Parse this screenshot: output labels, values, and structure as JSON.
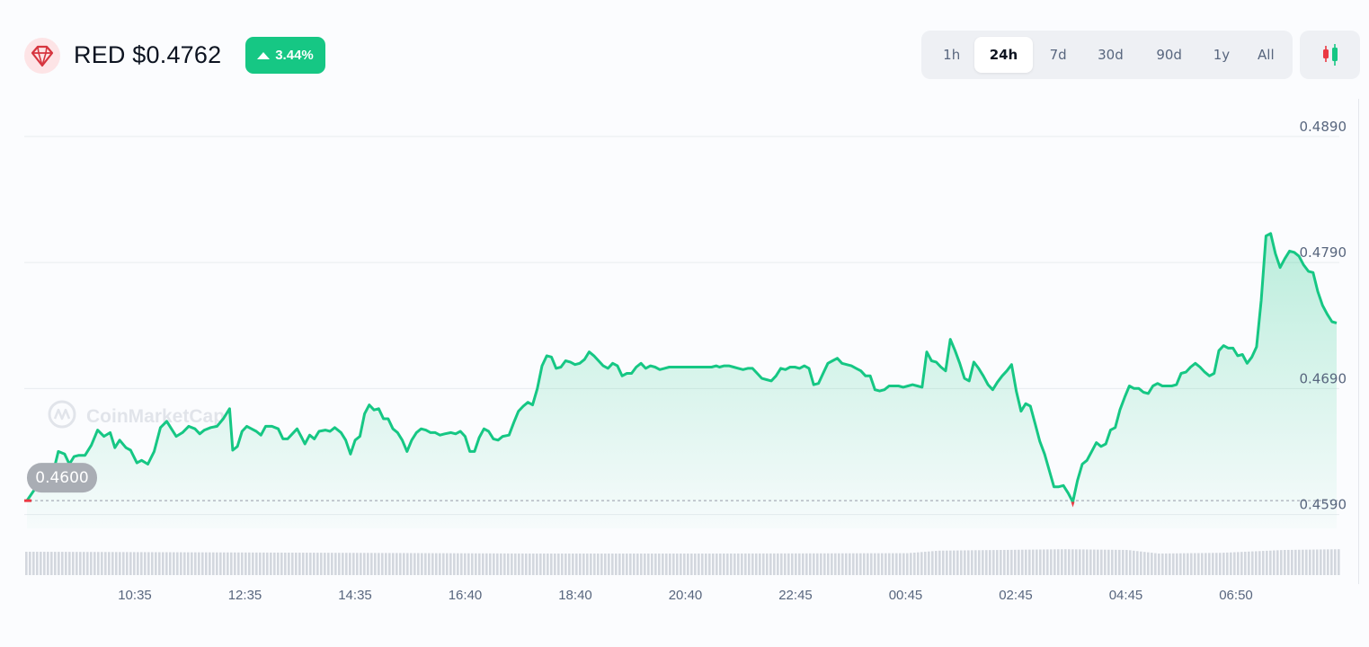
{
  "header": {
    "coin_symbol_price": "RED $0.4762",
    "change_pct": "3.44%",
    "logo_icon": "red-gem-icon",
    "accent_red": "#d6353f"
  },
  "ranges": [
    {
      "label": "1h",
      "active": false
    },
    {
      "label": "24h",
      "active": true
    },
    {
      "label": "7d",
      "active": false
    },
    {
      "label": "30d",
      "active": false
    },
    {
      "label": "90d",
      "active": false
    },
    {
      "label": "1y",
      "active": false
    },
    {
      "label": "All",
      "active": false
    }
  ],
  "candle_toggle_icon": "candlestick-icon",
  "watermark": "CoinMarketCap",
  "chart_data": {
    "type": "line",
    "color_up": "#16c784",
    "color_down": "#ea3943",
    "open_price_label": "0.4600",
    "open_price": 0.4601,
    "y_ticks": [
      "0.4890",
      "0.4790",
      "0.4690",
      "0.4590"
    ],
    "y_tick_values": [
      0.489,
      0.479,
      0.469,
      0.459
    ],
    "ylim": [
      0.4579,
      0.4897
    ],
    "x_ticks": [
      "10:35",
      "12:35",
      "14:35",
      "16:40",
      "18:40",
      "20:40",
      "22:45",
      "00:45",
      "02:45",
      "04:45",
      "06:50"
    ],
    "grid": true,
    "points": [
      [
        0,
        0.4601
      ],
      [
        0.3,
        0.4612
      ],
      [
        0.55,
        0.4618
      ],
      [
        0.8,
        0.462
      ],
      [
        1.0,
        0.464
      ],
      [
        1.2,
        0.4638
      ],
      [
        1.35,
        0.463
      ],
      [
        1.5,
        0.4636
      ],
      [
        1.65,
        0.4637
      ],
      [
        1.85,
        0.4637
      ],
      [
        2.05,
        0.4645
      ],
      [
        2.25,
        0.4657
      ],
      [
        2.45,
        0.4652
      ],
      [
        2.65,
        0.4655
      ],
      [
        2.8,
        0.4643
      ],
      [
        2.95,
        0.4649
      ],
      [
        3.15,
        0.4643
      ],
      [
        3.3,
        0.4641
      ],
      [
        3.5,
        0.4631
      ],
      [
        3.65,
        0.4633
      ],
      [
        3.85,
        0.463
      ],
      [
        4.05,
        0.464
      ],
      [
        4.25,
        0.4659
      ],
      [
        4.45,
        0.4664
      ],
      [
        4.6,
        0.4658
      ],
      [
        4.75,
        0.4652
      ],
      [
        4.95,
        0.4655
      ],
      [
        5.15,
        0.466
      ],
      [
        5.35,
        0.4658
      ],
      [
        5.5,
        0.4654
      ],
      [
        5.65,
        0.4657
      ],
      [
        5.85,
        0.4659
      ],
      [
        6.05,
        0.466
      ],
      [
        6.25,
        0.4666
      ],
      [
        6.45,
        0.4674
      ],
      [
        6.55,
        0.4641
      ],
      [
        6.7,
        0.4644
      ],
      [
        6.85,
        0.4656
      ],
      [
        7.0,
        0.466
      ],
      [
        7.15,
        0.4658
      ],
      [
        7.3,
        0.4656
      ],
      [
        7.45,
        0.4653
      ],
      [
        7.6,
        0.466
      ],
      [
        7.8,
        0.466
      ],
      [
        8.0,
        0.4658
      ],
      [
        8.15,
        0.465
      ],
      [
        8.3,
        0.465
      ],
      [
        8.45,
        0.4654
      ],
      [
        8.6,
        0.4658
      ],
      [
        8.75,
        0.4651
      ],
      [
        8.85,
        0.4646
      ],
      [
        9.0,
        0.4653
      ],
      [
        9.15,
        0.465
      ],
      [
        9.3,
        0.4656
      ],
      [
        9.5,
        0.4657
      ],
      [
        9.65,
        0.4656
      ],
      [
        9.8,
        0.4659
      ],
      [
        10.0,
        0.4655
      ],
      [
        10.15,
        0.4649
      ],
      [
        10.3,
        0.4638
      ],
      [
        10.45,
        0.4649
      ],
      [
        10.6,
        0.4652
      ],
      [
        10.75,
        0.467
      ],
      [
        10.9,
        0.4677
      ],
      [
        11.05,
        0.4673
      ],
      [
        11.2,
        0.4674
      ],
      [
        11.35,
        0.4666
      ],
      [
        11.5,
        0.4666
      ],
      [
        11.65,
        0.4658
      ],
      [
        11.8,
        0.4655
      ],
      [
        11.95,
        0.4649
      ],
      [
        12.1,
        0.464
      ],
      [
        12.25,
        0.4649
      ],
      [
        12.4,
        0.4655
      ],
      [
        12.55,
        0.4658
      ],
      [
        12.7,
        0.4657
      ],
      [
        12.85,
        0.4655
      ],
      [
        13.0,
        0.4655
      ],
      [
        13.15,
        0.4653
      ],
      [
        13.3,
        0.4654
      ],
      [
        13.5,
        0.4655
      ],
      [
        13.65,
        0.4654
      ],
      [
        13.8,
        0.4656
      ],
      [
        13.95,
        0.4652
      ],
      [
        14.1,
        0.464
      ],
      [
        14.25,
        0.464
      ],
      [
        14.4,
        0.4651
      ],
      [
        14.55,
        0.4658
      ],
      [
        14.7,
        0.4656
      ],
      [
        14.85,
        0.465
      ],
      [
        15.0,
        0.4649
      ],
      [
        15.15,
        0.4652
      ],
      [
        15.35,
        0.4653
      ],
      [
        15.5,
        0.4663
      ],
      [
        15.65,
        0.4672
      ],
      [
        15.8,
        0.4676
      ],
      [
        15.95,
        0.4679
      ],
      [
        16.1,
        0.4677
      ],
      [
        16.25,
        0.469
      ],
      [
        16.4,
        0.4708
      ],
      [
        16.55,
        0.4716
      ],
      [
        16.7,
        0.4715
      ],
      [
        16.85,
        0.4706
      ],
      [
        17.0,
        0.4707
      ],
      [
        17.15,
        0.4712
      ],
      [
        17.3,
        0.4711
      ],
      [
        17.45,
        0.4709
      ],
      [
        17.6,
        0.471
      ],
      [
        17.75,
        0.4713
      ],
      [
        17.9,
        0.4719
      ],
      [
        18.05,
        0.4716
      ],
      [
        18.2,
        0.4712
      ],
      [
        18.35,
        0.4708
      ],
      [
        18.5,
        0.4706
      ],
      [
        18.65,
        0.471
      ],
      [
        18.8,
        0.4708
      ],
      [
        18.95,
        0.47
      ],
      [
        19.1,
        0.4702
      ],
      [
        19.25,
        0.4702
      ],
      [
        19.4,
        0.4707
      ],
      [
        19.55,
        0.471
      ],
      [
        19.7,
        0.4706
      ],
      [
        19.85,
        0.4708
      ],
      [
        20.0,
        0.4707
      ],
      [
        20.15,
        0.4705
      ],
      [
        20.3,
        0.4706
      ],
      [
        20.45,
        0.4707
      ],
      [
        20.6,
        0.4707
      ],
      [
        20.75,
        0.4707
      ],
      [
        20.9,
        0.4707
      ],
      [
        21.05,
        0.4707
      ],
      [
        21.2,
        0.4707
      ],
      [
        21.35,
        0.4707
      ],
      [
        21.5,
        0.4707
      ],
      [
        21.65,
        0.4707
      ],
      [
        21.8,
        0.4707
      ],
      [
        21.95,
        0.4708
      ],
      [
        22.05,
        0.4707
      ],
      [
        22.2,
        0.4708
      ],
      [
        22.35,
        0.4708
      ],
      [
        22.5,
        0.4707
      ],
      [
        22.65,
        0.4706
      ],
      [
        22.8,
        0.4705
      ],
      [
        22.95,
        0.4706
      ],
      [
        23.1,
        0.4706
      ],
      [
        23.25,
        0.4702
      ],
      [
        23.4,
        0.4698
      ],
      [
        23.55,
        0.4697
      ],
      [
        23.7,
        0.4696
      ],
      [
        23.85,
        0.47
      ],
      [
        24.0,
        0.4706
      ],
      [
        24.15,
        0.4705
      ],
      [
        24.3,
        0.4707
      ],
      [
        24.45,
        0.4707
      ],
      [
        24.6,
        0.4706
      ],
      [
        24.75,
        0.4708
      ],
      [
        24.9,
        0.4706
      ],
      [
        25.05,
        0.4693
      ],
      [
        25.2,
        0.4694
      ],
      [
        25.35,
        0.4702
      ],
      [
        25.5,
        0.471
      ],
      [
        25.65,
        0.4712
      ],
      [
        25.8,
        0.4714
      ],
      [
        25.95,
        0.471
      ],
      [
        26.1,
        0.4709
      ],
      [
        26.25,
        0.4708
      ],
      [
        26.4,
        0.4706
      ],
      [
        26.55,
        0.4704
      ],
      [
        26.7,
        0.47
      ],
      [
        26.85,
        0.47
      ],
      [
        27.0,
        0.4689
      ],
      [
        27.15,
        0.4688
      ],
      [
        27.3,
        0.4689
      ],
      [
        27.45,
        0.4692
      ],
      [
        27.6,
        0.4692
      ],
      [
        27.75,
        0.4692
      ],
      [
        27.9,
        0.4691
      ],
      [
        28.05,
        0.4692
      ],
      [
        28.2,
        0.4693
      ],
      [
        28.35,
        0.4692
      ],
      [
        28.5,
        0.4691
      ],
      [
        28.65,
        0.4719
      ],
      [
        28.8,
        0.4712
      ],
      [
        28.95,
        0.4711
      ],
      [
        29.1,
        0.4707
      ],
      [
        29.25,
        0.4704
      ],
      [
        29.4,
        0.4729
      ],
      [
        29.55,
        0.472
      ],
      [
        29.7,
        0.471
      ],
      [
        29.85,
        0.4698
      ],
      [
        30.0,
        0.4696
      ],
      [
        30.15,
        0.4711
      ],
      [
        30.3,
        0.4706
      ],
      [
        30.45,
        0.47
      ],
      [
        30.6,
        0.4693
      ],
      [
        30.75,
        0.4689
      ],
      [
        30.9,
        0.4695
      ],
      [
        31.05,
        0.47
      ],
      [
        31.2,
        0.4704
      ],
      [
        31.35,
        0.4709
      ],
      [
        31.5,
        0.4688
      ],
      [
        31.65,
        0.4672
      ],
      [
        31.8,
        0.4678
      ],
      [
        31.95,
        0.4676
      ],
      [
        32.1,
        0.4662
      ],
      [
        32.25,
        0.4648
      ],
      [
        32.4,
        0.4638
      ],
      [
        32.55,
        0.4625
      ],
      [
        32.7,
        0.4612
      ],
      [
        32.85,
        0.4612
      ],
      [
        33.0,
        0.4613
      ],
      [
        33.15,
        0.4607
      ],
      [
        33.3,
        0.46
      ],
      [
        33.45,
        0.4617
      ],
      [
        33.6,
        0.463
      ],
      [
        33.75,
        0.4633
      ],
      [
        33.9,
        0.464
      ],
      [
        34.05,
        0.4647
      ],
      [
        34.2,
        0.4644
      ],
      [
        34.35,
        0.4646
      ],
      [
        34.5,
        0.4657
      ],
      [
        34.65,
        0.4659
      ],
      [
        34.8,
        0.4673
      ],
      [
        34.95,
        0.4683
      ],
      [
        35.1,
        0.4692
      ],
      [
        35.25,
        0.469
      ],
      [
        35.4,
        0.469
      ],
      [
        35.55,
        0.4687
      ],
      [
        35.7,
        0.4686
      ],
      [
        35.85,
        0.4692
      ],
      [
        36.0,
        0.4694
      ],
      [
        36.15,
        0.4692
      ],
      [
        36.3,
        0.4692
      ],
      [
        36.45,
        0.4692
      ],
      [
        36.6,
        0.4693
      ],
      [
        36.75,
        0.4702
      ],
      [
        36.9,
        0.4703
      ],
      [
        37.05,
        0.4707
      ],
      [
        37.2,
        0.471
      ],
      [
        37.35,
        0.4707
      ],
      [
        37.5,
        0.4703
      ],
      [
        37.65,
        0.47
      ],
      [
        37.8,
        0.4702
      ],
      [
        37.95,
        0.472
      ],
      [
        38.1,
        0.4724
      ],
      [
        38.25,
        0.4722
      ],
      [
        38.4,
        0.4722
      ],
      [
        38.55,
        0.4716
      ],
      [
        38.7,
        0.4717
      ],
      [
        38.85,
        0.471
      ],
      [
        39.0,
        0.4715
      ],
      [
        39.15,
        0.4723
      ],
      [
        39.3,
        0.476
      ],
      [
        39.45,
        0.4811
      ],
      [
        39.6,
        0.4813
      ],
      [
        39.75,
        0.4797
      ],
      [
        39.9,
        0.4786
      ],
      [
        40.05,
        0.4793
      ],
      [
        40.2,
        0.4799
      ],
      [
        40.35,
        0.4798
      ],
      [
        40.5,
        0.4795
      ],
      [
        40.65,
        0.4788
      ],
      [
        40.8,
        0.4783
      ],
      [
        40.95,
        0.4782
      ],
      [
        41.1,
        0.4767
      ],
      [
        41.25,
        0.4756
      ],
      [
        41.4,
        0.4749
      ],
      [
        41.55,
        0.4743
      ],
      [
        41.7,
        0.4742
      ]
    ],
    "x_end": 41.7,
    "volume_profile": [
      [
        0,
        0.65
      ],
      [
        10,
        0.62
      ],
      [
        16,
        0.6
      ],
      [
        22,
        0.6
      ],
      [
        28,
        0.61
      ],
      [
        29,
        0.68
      ],
      [
        33,
        0.72
      ],
      [
        35,
        0.7
      ],
      [
        36,
        0.6
      ],
      [
        38,
        0.62
      ],
      [
        39,
        0.66
      ],
      [
        40,
        0.7
      ],
      [
        41.7,
        0.72
      ]
    ]
  }
}
